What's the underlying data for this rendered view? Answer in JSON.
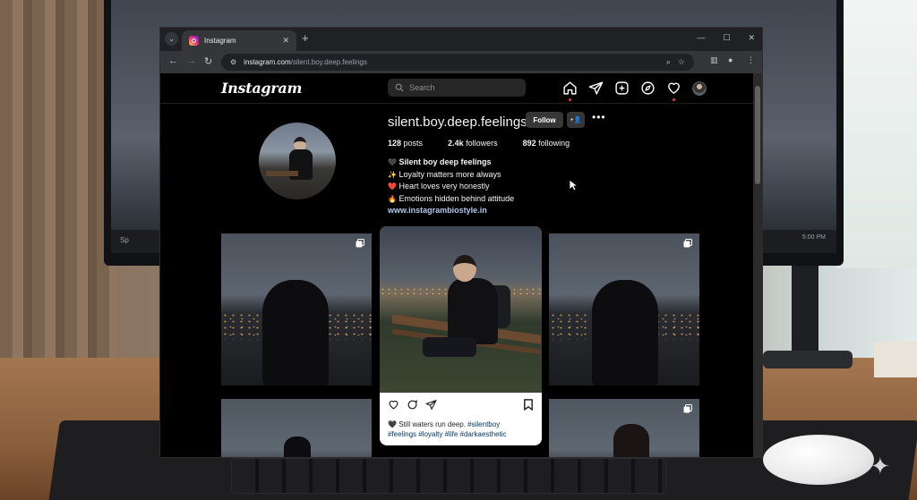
{
  "browser": {
    "tab_title": "Instagram",
    "url_domain": "instagram.com",
    "url_path": "/silent.boy.deep.feelings",
    "back_monitor_taskbar_left": "Sp",
    "back_monitor_clock": "5:00 PM"
  },
  "instagram": {
    "logo": "Instagram",
    "search_placeholder": "Search",
    "nav_icons": [
      "home-icon",
      "send-icon",
      "create-icon",
      "explore-icon",
      "heart-icon",
      "avatar"
    ],
    "profile": {
      "username": "silent.boy.deep.feelings",
      "follow_label": "Follow",
      "suggest_label": "+Ջ",
      "more_label": "•••",
      "stats": [
        {
          "value": "128",
          "label": "posts"
        },
        {
          "value": "2.4k",
          "label": "followers"
        },
        {
          "value": "892",
          "label": "following"
        }
      ],
      "bio": {
        "name_emoji": "🖤",
        "name": "Silent boy deep feelings",
        "lines": [
          {
            "emoji": "✨",
            "text": "Loyalty matters more always"
          },
          {
            "emoji": "❤️",
            "text": "Heart loves very honestly"
          },
          {
            "emoji": "🔥",
            "text": "Emotions hidden behind attitude"
          }
        ],
        "link": "www.instagrambiostyle.in"
      }
    },
    "featured_post": {
      "caption_emoji": "🖤",
      "caption_text": "Still waters run deep.",
      "caption_tag1": "#silentboy",
      "caption_tags": "#feelings #loyalty #life #darkaesthetic"
    }
  },
  "colors": {
    "instagram_bg": "#000000",
    "link": "#b0cbed",
    "notification_dot": "#ff3040",
    "hashtag": "#00376b"
  }
}
